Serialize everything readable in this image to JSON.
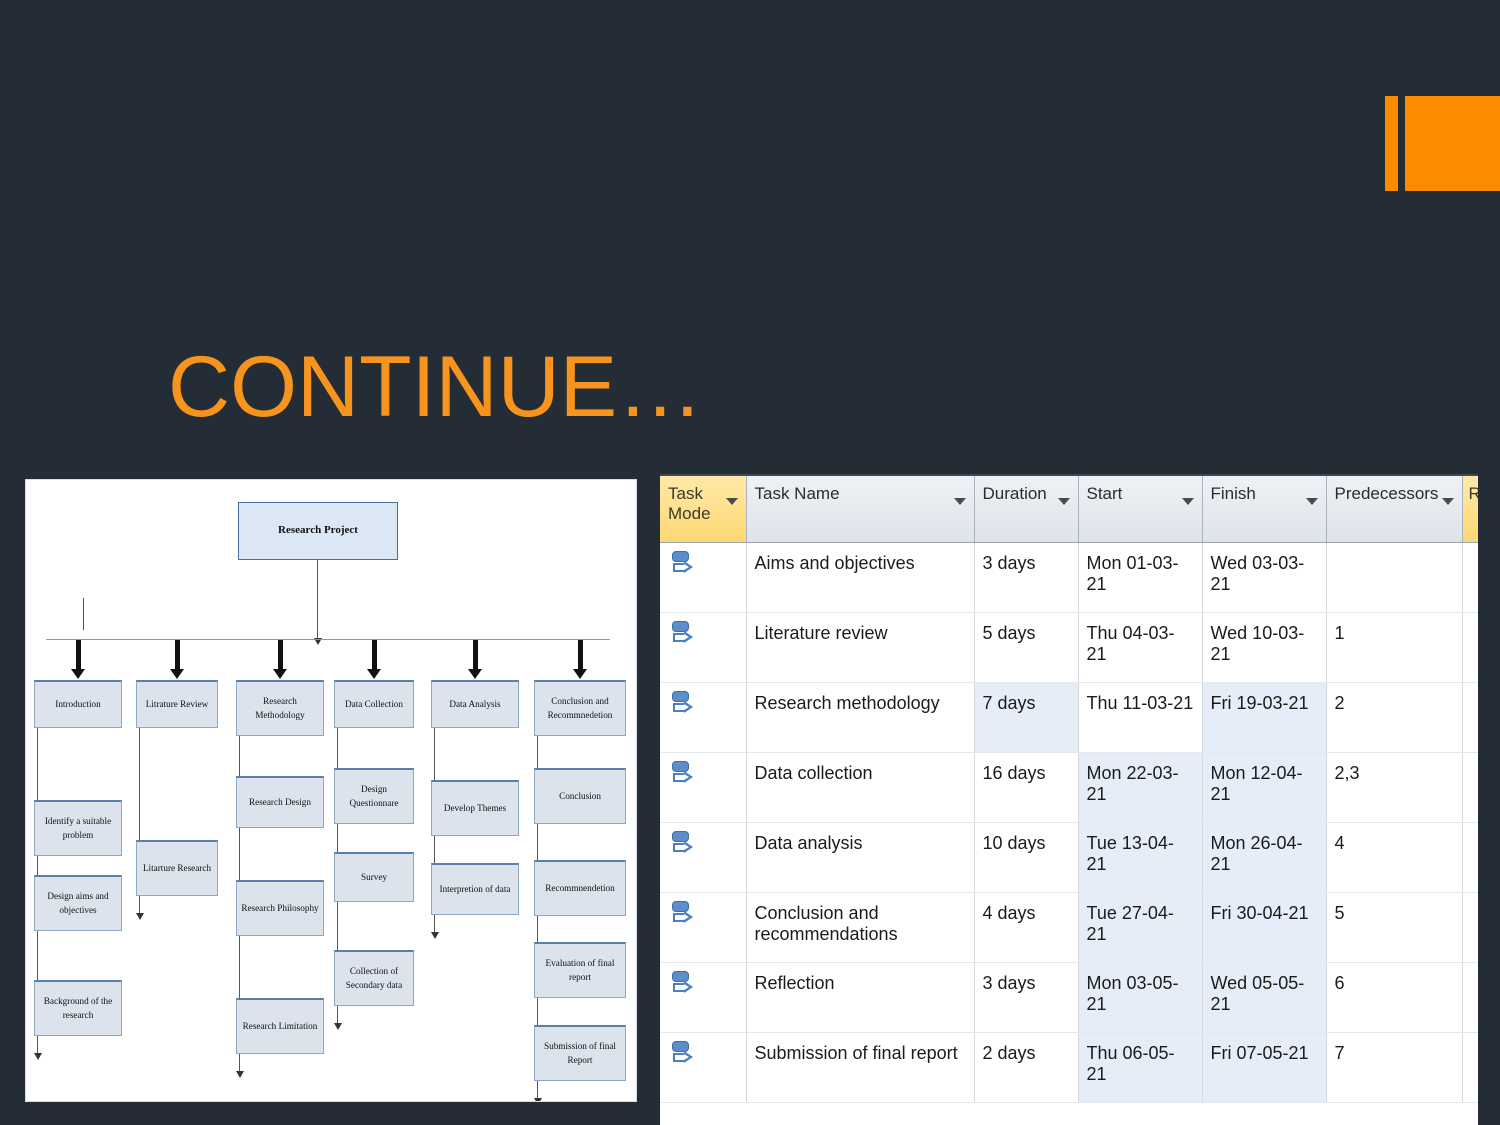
{
  "slide": {
    "background_color": "#242d36",
    "accent_color": "#f7941e",
    "title": "CONTINUE…"
  },
  "decoration": {
    "thin_bar_name": "orange-thin-bar",
    "thick_bar_name": "orange-block"
  },
  "flowchart": {
    "root": "Research Project",
    "columns": [
      {
        "head": "Introduction",
        "children": [
          "Identify a suitable problem",
          "Design aims and objectives",
          "Background of the research"
        ]
      },
      {
        "head": "Litrature Review",
        "children": [
          "Litarture Research"
        ]
      },
      {
        "head": "Research Methodology",
        "children": [
          "Research Design",
          "Research Philosophy",
          "Research Limitation"
        ]
      },
      {
        "head": "Data Collection",
        "children": [
          "Design Questionnare",
          "Survey",
          "Collection of Secondary data"
        ]
      },
      {
        "head": "Data Analysis",
        "children": [
          "Develop Themes",
          "Interpretion of data"
        ]
      },
      {
        "head": "Conclusion and Recommnedetion",
        "children": [
          "Conclusion",
          "Recommnendetion",
          "Evaluation of final report",
          "Submission of final Report"
        ]
      }
    ]
  },
  "project_grid": {
    "columns": [
      {
        "label": "Task Mode",
        "highlighted": true
      },
      {
        "label": "Task Name",
        "highlighted": false
      },
      {
        "label": "Duration",
        "highlighted": false
      },
      {
        "label": "Start",
        "highlighted": false
      },
      {
        "label": "Finish",
        "highlighted": false
      },
      {
        "label": "Predecessors",
        "highlighted": false
      },
      {
        "label": "R",
        "highlighted": true
      }
    ],
    "rows": [
      {
        "mode_icon": "manually-scheduled-icon",
        "name": "Aims and objectives",
        "duration": "3 days",
        "start": "Mon 01-03-21",
        "finish": "Wed 03-03-21",
        "predecessors": "",
        "shade": {
          "duration": false,
          "start": false,
          "finish": false
        }
      },
      {
        "mode_icon": "manually-scheduled-icon",
        "name": "Literature review",
        "duration": "5 days",
        "start": "Thu 04-03-21",
        "finish": "Wed 10-03-21",
        "predecessors": "1",
        "shade": {
          "duration": false,
          "start": false,
          "finish": false
        }
      },
      {
        "mode_icon": "manually-scheduled-icon",
        "name": "Research methodology",
        "duration": "7 days",
        "start": "Thu 11-03-21",
        "finish": "Fri 19-03-21",
        "predecessors": "2",
        "shade": {
          "duration": true,
          "start": false,
          "finish": true
        }
      },
      {
        "mode_icon": "manually-scheduled-icon",
        "name": "Data collection",
        "duration": "16 days",
        "start": "Mon 22-03-21",
        "finish": "Mon 12-04-21",
        "predecessors": "2,3",
        "shade": {
          "duration": false,
          "start": true,
          "finish": true
        }
      },
      {
        "mode_icon": "manually-scheduled-icon",
        "name": "Data analysis",
        "duration": "10 days",
        "start": "Tue 13-04-21",
        "finish": "Mon 26-04-21",
        "predecessors": "4",
        "shade": {
          "duration": false,
          "start": true,
          "finish": true
        }
      },
      {
        "mode_icon": "manually-scheduled-icon",
        "name": "Conclusion and recommendations",
        "duration": "4 days",
        "start": "Tue 27-04-21",
        "finish": "Fri 30-04-21",
        "predecessors": "5",
        "shade": {
          "duration": false,
          "start": true,
          "finish": true
        }
      },
      {
        "mode_icon": "manually-scheduled-icon",
        "name": "Reflection",
        "duration": "3 days",
        "start": "Mon 03-05-21",
        "finish": "Wed 05-05-21",
        "predecessors": "6",
        "shade": {
          "duration": false,
          "start": true,
          "finish": true
        }
      },
      {
        "mode_icon": "manually-scheduled-icon",
        "name": "Submission of final report",
        "duration": "2 days",
        "start": "Thu 06-05-21",
        "finish": "Fri 07-05-21",
        "predecessors": "7",
        "shade": {
          "duration": false,
          "start": true,
          "finish": true
        }
      }
    ]
  }
}
